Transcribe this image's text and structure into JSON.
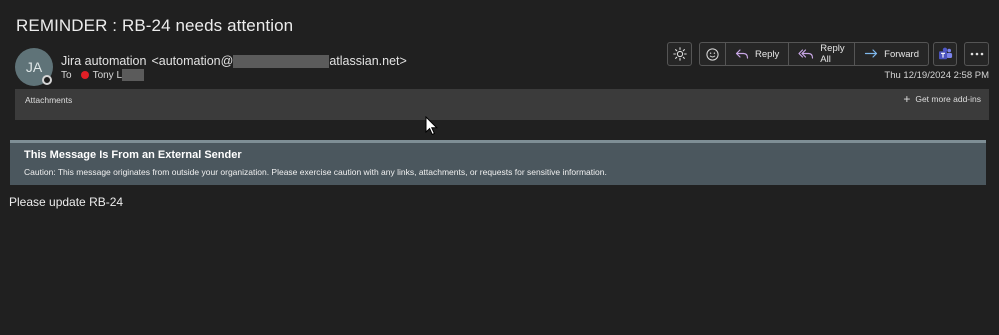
{
  "email": {
    "subject": "REMINDER : RB-24 needs attention",
    "avatar_initials": "JA",
    "sender_name": "Jira automation",
    "sender_email_prefix": "<automation@",
    "sender_email_suffix": "atlassian.net>",
    "to_label": "To",
    "recipient_name": "Tony L",
    "date": "Thu 12/19/2024 2:58 PM",
    "body": "Please update RB-24"
  },
  "toolbar": {
    "reply_label": "Reply",
    "reply_all_label": "Reply All",
    "forward_label": "Forward"
  },
  "attachments": {
    "label": "Attachments",
    "addins_label": "Get more add-ins"
  },
  "banner": {
    "title": "This Message Is From an External Sender",
    "text": "Caution: This message originates from outside your organization. Please exercise caution with any links, attachments, or requests for sensitive information."
  },
  "colors": {
    "background": "#202020",
    "banner": "#4b575e",
    "presence_busy": "#e01f26",
    "reply_icon": "#c9a7e6",
    "forward_icon": "#7fb8ec"
  }
}
